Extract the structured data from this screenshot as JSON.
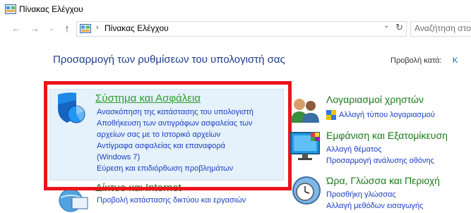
{
  "window": {
    "title": "Πίνακας Ελέγχου"
  },
  "address": {
    "path": "Πίνακας Ελέγχου",
    "search_placeholder": "Αναζήτηση στο"
  },
  "main": {
    "heading": "Προσαρμογή των ρυθμίσεων του υπολογιστή σας",
    "view_by_label": "Προβολή κατά:",
    "view_by_value": "K"
  },
  "categories": {
    "system_security": {
      "title": "Σύστημα και Ασφάλεια",
      "links": [
        "Ανασκόπηση της κατάστασης του υπολογιστή",
        "Αποθήκευση των αντιγράφων ασφαλείας των",
        "αρχείων σας με το Ιστορικό αρχείων",
        "Αντίγραφα ασφαλείας και επαναφορά",
        "(Windows 7)",
        "Εύρεση και επιδιόρθωση προβλημάτων"
      ]
    },
    "network": {
      "title": "Δίκτυο και Internet",
      "links": [
        "Προβολή κατάστασης δικτύου και εργασιών"
      ]
    },
    "user_accounts": {
      "title": "Λογαριασμοί χρηστών",
      "links": [
        "Αλλαγή τύπου λογαριασμού"
      ]
    },
    "appearance": {
      "title": "Εμφάνιση και Εξατομίκευση",
      "links": [
        "Αλλαγή θέματος",
        "Προσαρμογή ανάλυσης οθόνης"
      ]
    },
    "clock_region": {
      "title": "Ώρα, Γλώσσα και Περιοχή",
      "links": [
        "Προσθήκη γλώσσας",
        "Αλλαγή μεθόδων εισαγωγής"
      ]
    }
  },
  "colors": {
    "highlight_frame": "#e8151b",
    "accent_link": "#1a3fbf",
    "category_green": "#2a9d2a"
  }
}
